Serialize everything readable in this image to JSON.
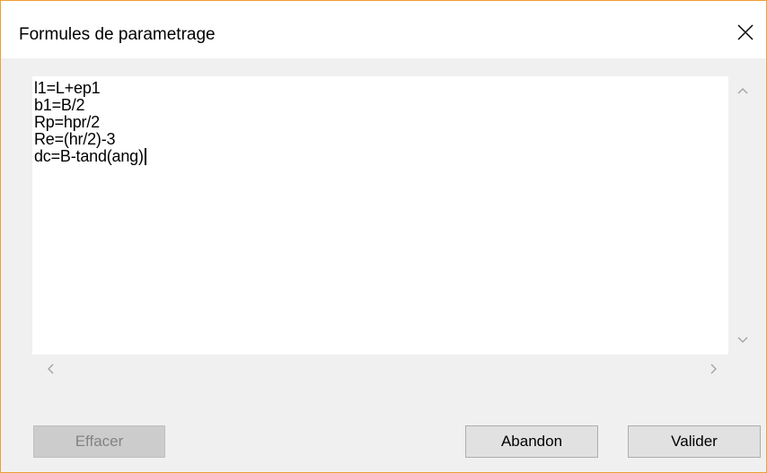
{
  "window": {
    "title": "Formules de parametrage",
    "accent_border_color": "#f0a030"
  },
  "editor": {
    "lines": [
      "l1=L+ep1",
      "b1=B/2",
      "Rp=hpr/2",
      "Re=(hr/2)-3",
      "dc=B-tand(ang)"
    ]
  },
  "icons": {
    "close": "close-icon",
    "scroll_up": "chevron-up-icon",
    "scroll_down": "chevron-down-icon",
    "scroll_left": "chevron-left-icon",
    "scroll_right": "chevron-right-icon"
  },
  "buttons": {
    "clear_label": "Effacer",
    "clear_enabled": false,
    "cancel_label": "Abandon",
    "validate_label": "Valider"
  }
}
